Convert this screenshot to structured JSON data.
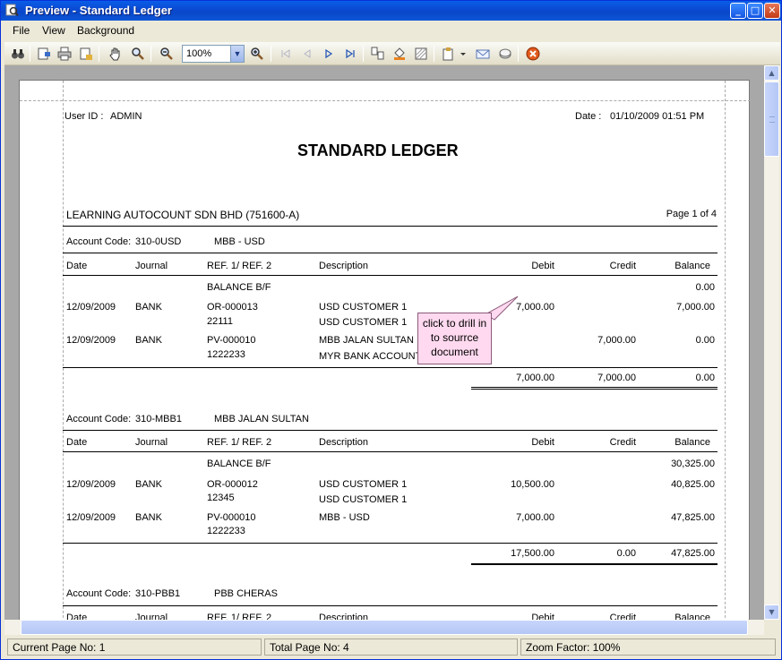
{
  "window": {
    "title": "Preview - Standard Ledger"
  },
  "menu": {
    "file": "File",
    "view": "View",
    "background": "Background"
  },
  "toolbar": {
    "zoom_value": "100%"
  },
  "report": {
    "user_id_label": "User ID :",
    "user_id": "ADMIN",
    "date_label": "Date :",
    "date": "01/10/2009 01:51 PM",
    "title": "STANDARD LEDGER",
    "company": "LEARNING AUTOCOUNT SDN BHD (751600-A)",
    "page_info": "Page 1 of 4",
    "columns": {
      "date": "Date",
      "journal": "Journal",
      "ref": "REF. 1/ REF. 2",
      "description": "Description",
      "debit": "Debit",
      "credit": "Credit",
      "balance": "Balance"
    },
    "accounts": [
      {
        "code_label": "Account Code:",
        "code": "310-0USD",
        "name": "MBB - USD",
        "balance_bf_label": "BALANCE B/F",
        "balance_bf": "0.00",
        "rows": [
          {
            "date": "12/09/2009",
            "journal": "BANK",
            "ref1": "OR-000013",
            "ref2": "22111",
            "desc1": "USD CUSTOMER 1",
            "desc2": "USD CUSTOMER 1",
            "debit": "7,000.00",
            "credit": "",
            "balance": "7,000.00"
          },
          {
            "date": "12/09/2009",
            "journal": "BANK",
            "ref1": "PV-000010",
            "ref2": "1222233",
            "desc1": "MBB JALAN SULTAN",
            "desc2": "MYR BANK ACCOUNT",
            "debit": "",
            "credit": "7,000.00",
            "balance": "0.00"
          }
        ],
        "total_debit": "7,000.00",
        "total_credit": "7,000.00",
        "total_balance": "0.00"
      },
      {
        "code_label": "Account Code:",
        "code": "310-MBB1",
        "name": "MBB JALAN SULTAN",
        "balance_bf_label": "BALANCE B/F",
        "balance_bf": "30,325.00",
        "rows": [
          {
            "date": "12/09/2009",
            "journal": "BANK",
            "ref1": "OR-000012",
            "ref2": "12345",
            "desc1": "USD CUSTOMER 1",
            "desc2": "USD CUSTOMER 1",
            "debit": "10,500.00",
            "credit": "",
            "balance": "40,825.00"
          },
          {
            "date": "12/09/2009",
            "journal": "BANK",
            "ref1": "PV-000010",
            "ref2": "1222233",
            "desc1": "MBB - USD",
            "desc2": "",
            "debit": "7,000.00",
            "credit": "",
            "balance": "47,825.00"
          }
        ],
        "total_debit": "17,500.00",
        "total_credit": "0.00",
        "total_balance": "47,825.00"
      },
      {
        "code_label": "Account Code:",
        "code": "310-PBB1",
        "name": "PBB CHERAS"
      }
    ]
  },
  "callout": {
    "text": "click to drill in to sourrce document"
  },
  "status": {
    "current_page": "Current Page No: 1",
    "total_page": "Total Page No: 4",
    "zoom_factor": "Zoom Factor: 100%"
  }
}
